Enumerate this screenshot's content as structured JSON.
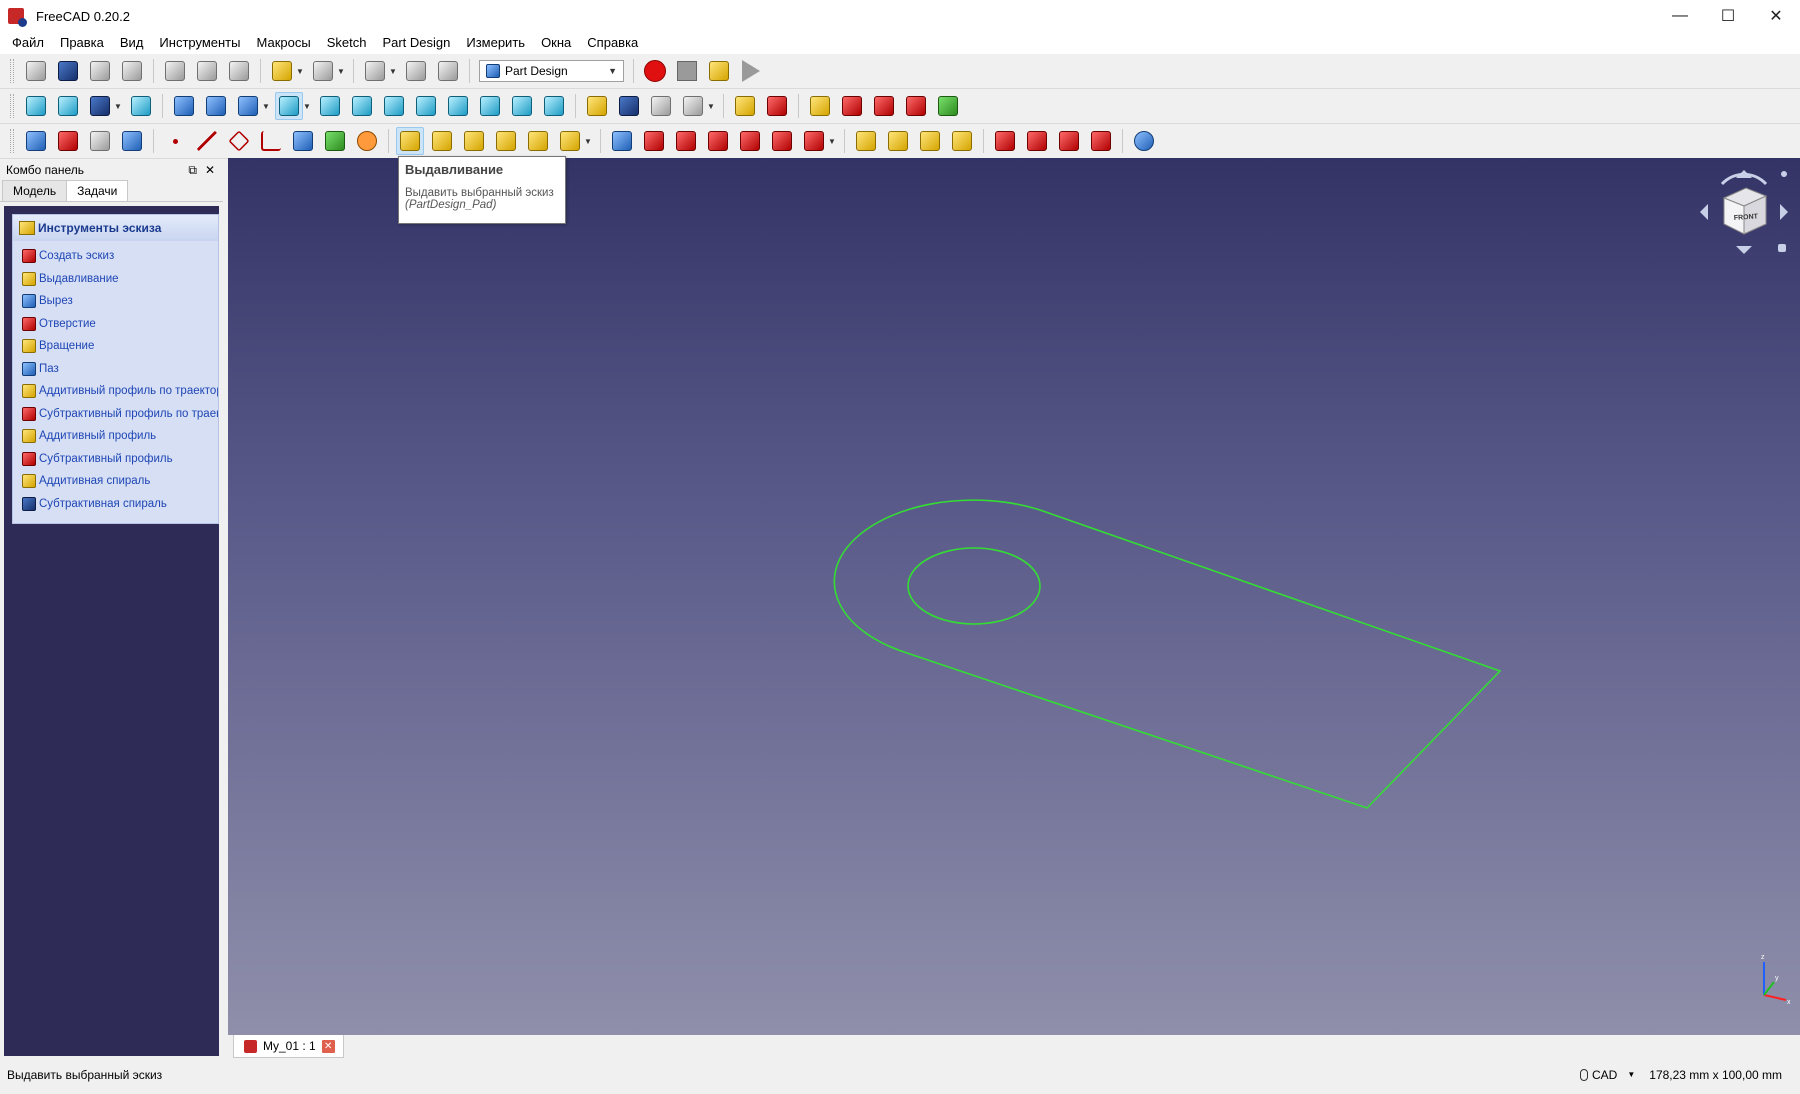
{
  "window": {
    "title": "FreeCAD 0.20.2",
    "minimize": "—",
    "maximize": "☐",
    "close": "✕"
  },
  "menu": [
    "Файл",
    "Правка",
    "Вид",
    "Инструменты",
    "Макросы",
    "Sketch",
    "Part Design",
    "Измерить",
    "Окна",
    "Справка"
  ],
  "workbench": {
    "selected": "Part Design"
  },
  "combo_panel": {
    "title": "Комбо панель",
    "float_icon": "⧉",
    "close_icon": "✕",
    "tabs": [
      "Модель",
      "Задачи"
    ],
    "active_tab": "Задачи",
    "task_box": {
      "title": "Инструменты эскиза",
      "items": [
        "Создать эскиз",
        "Выдавливание",
        "Вырез",
        "Отверстие",
        "Вращение",
        "Паз",
        "Аддитивный профиль по траектории",
        "Субтрактивный профиль по траектории",
        "Аддитивный профиль",
        "Субтрактивный профиль",
        "Аддитивная спираль",
        "Субтрактивная спираль"
      ]
    }
  },
  "tooltip": {
    "title": "Выдавливание",
    "text": "Выдавить выбранный эскиз",
    "command": "(PartDesign_Pad)"
  },
  "document_tab": {
    "label": "My_01 : 1",
    "close": "✕"
  },
  "status_bar": {
    "message": "Выдавить выбранный эскиз",
    "nav_style": "CAD",
    "dimensions": "178,23 mm x 100,00 mm"
  },
  "navcube": {
    "face_label": "FRONT"
  },
  "axes": {
    "x": "x",
    "y": "y",
    "z": "z"
  },
  "colors": {
    "sketch_line": "#33dd33",
    "view_top": "#333366",
    "view_bottom": "#8f8fab",
    "task_link": "#1f46b5",
    "record": "#e01010"
  }
}
